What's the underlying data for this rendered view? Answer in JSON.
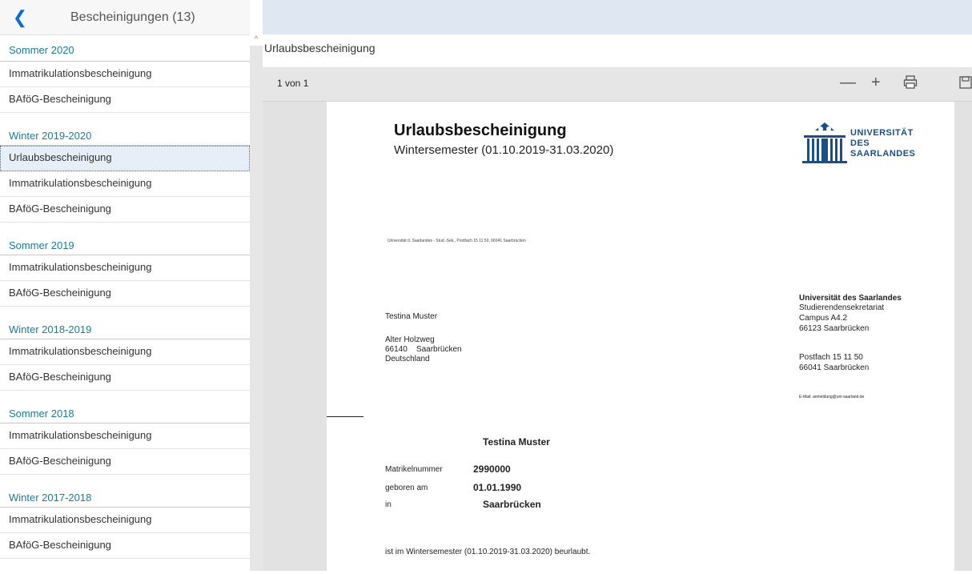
{
  "sidebar": {
    "title": "Bescheinigungen (13)",
    "groups": [
      {
        "name": "Sommer 2020",
        "items": [
          "Immatrikulationsbescheinigung",
          "BAföG-Bescheinigung"
        ]
      },
      {
        "name": "Winter 2019-2020",
        "items": [
          "Urlaubsbescheinigung",
          "Immatrikulationsbescheinigung",
          "BAföG-Bescheinigung"
        ]
      },
      {
        "name": "Sommer 2019",
        "items": [
          "Immatrikulationsbescheinigung",
          "BAföG-Bescheinigung"
        ]
      },
      {
        "name": "Winter 2018-2019",
        "items": [
          "Immatrikulationsbescheinigung",
          "BAföG-Bescheinigung"
        ]
      },
      {
        "name": "Sommer 2018",
        "items": [
          "Immatrikulationsbescheinigung",
          "BAföG-Bescheinigung"
        ]
      },
      {
        "name": "Winter 2017-2018",
        "items": [
          "Immatrikulationsbescheinigung",
          "BAföG-Bescheinigung"
        ]
      }
    ]
  },
  "viewer": {
    "doc_title": "Urlaubsbescheinigung",
    "page_count": "1 von 1",
    "icons": [
      "minus-icon",
      "plus-icon",
      "print-icon",
      "save-icon"
    ]
  },
  "document": {
    "title": "Urlaubsbescheinigung",
    "subtitle": "Wintersemester (01.10.2019-31.03.2020)",
    "logo_lines": [
      "UNIVERSITÄT",
      "DES",
      "SAARLANDES"
    ],
    "sender_line": "Universität d. Saarlandes - Stud.-Sek., Postfach 15 11 50, 66041 Saarbrücken",
    "recipient_name": "Testina Muster",
    "recipient_street": "Alter Holzweg",
    "recipient_city": "66140    Saarbrücken",
    "recipient_country": "Deutschland",
    "uni_name": "Universität des Saarlandes",
    "uni_dept": "Studierendensekretariat",
    "uni_campus": "Campus A4.2",
    "uni_city": "66123 Saarbrücken",
    "uni_postfach": "Postfach 15 11 50",
    "uni_postcity": "66041 Saarbrücken",
    "uni_email": "E-Mail: anmeldung@uni-saarland.de",
    "student_name": "Testina Muster",
    "label_matrikel": "Matrikelnummer",
    "matrikel": "2990000",
    "label_born": "geboren am",
    "born": "01.01.1990",
    "label_in": "in",
    "birthplace": "Saarbrücken",
    "statement": "ist im Wintersemester (01.10.2019-31.03.2020) beurlaubt."
  }
}
